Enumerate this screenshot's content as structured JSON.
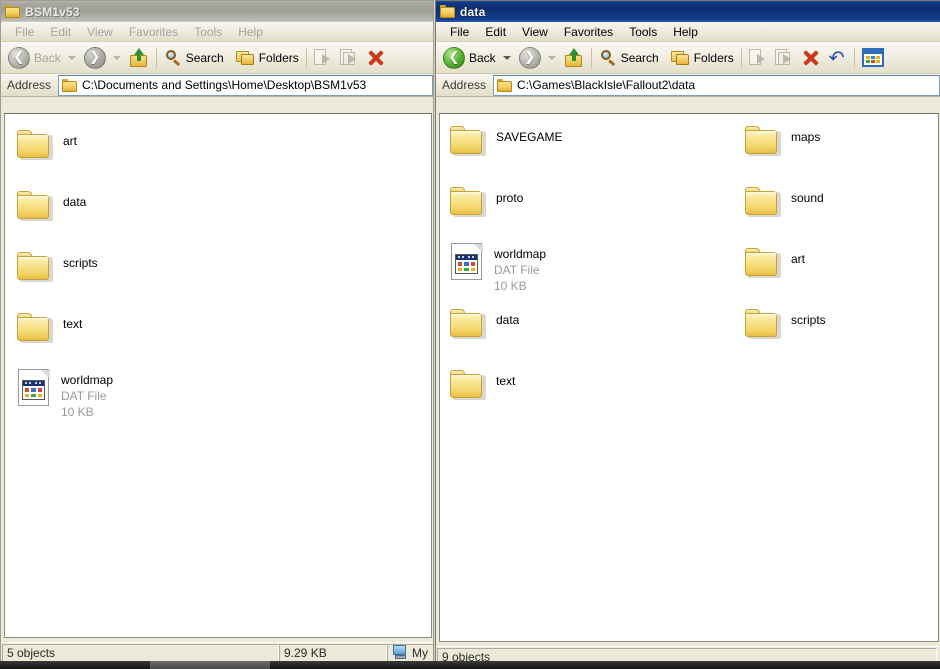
{
  "windows": {
    "left": {
      "title": "BSM1v53",
      "active": false,
      "menu": [
        "File",
        "Edit",
        "View",
        "Favorites",
        "Tools",
        "Help"
      ],
      "toolbar": {
        "back_label": "Back",
        "search_label": "Search",
        "folders_label": "Folders"
      },
      "address": {
        "label": "Address",
        "value": "C:\\Documents and Settings\\Home\\Desktop\\BSM1v53"
      },
      "items": [
        {
          "name": "art",
          "type": "folder"
        },
        {
          "name": "data",
          "type": "folder"
        },
        {
          "name": "scripts",
          "type": "folder"
        },
        {
          "name": "text",
          "type": "folder"
        },
        {
          "name": "worldmap",
          "type": "file",
          "kind": "DAT File",
          "size": "10 KB"
        }
      ],
      "status": {
        "objects": "5 objects",
        "size": "9.29 KB",
        "location": "My"
      }
    },
    "right": {
      "title": "data",
      "active": true,
      "menu": [
        "File",
        "Edit",
        "View",
        "Favorites",
        "Tools",
        "Help"
      ],
      "toolbar": {
        "back_label": "Back",
        "search_label": "Search",
        "folders_label": "Folders"
      },
      "address": {
        "label": "Address",
        "value": "C:\\Games\\BlackIsle\\Fallout2\\data"
      },
      "items_col1": [
        {
          "name": "SAVEGAME",
          "type": "folder"
        },
        {
          "name": "proto",
          "type": "folder"
        },
        {
          "name": "worldmap",
          "type": "file",
          "kind": "DAT File",
          "size": "10 KB"
        },
        {
          "name": "data",
          "type": "folder"
        },
        {
          "name": "text",
          "type": "folder"
        }
      ],
      "items_col2": [
        {
          "name": "maps",
          "type": "folder"
        },
        {
          "name": "sound",
          "type": "folder"
        },
        {
          "name": "art",
          "type": "folder"
        },
        {
          "name": "scripts",
          "type": "folder"
        }
      ],
      "status": {
        "objects": "9 objects"
      }
    }
  },
  "colors": {
    "active_title": "#0c2f72",
    "inactive_title": "#a9a9a1",
    "window_face": "#ece9d8",
    "folder_yellow": "#f6dd7d",
    "delete_red": "#cc3a1d",
    "undo_blue": "#1d4fa5",
    "back_green": "#5fb93b"
  }
}
